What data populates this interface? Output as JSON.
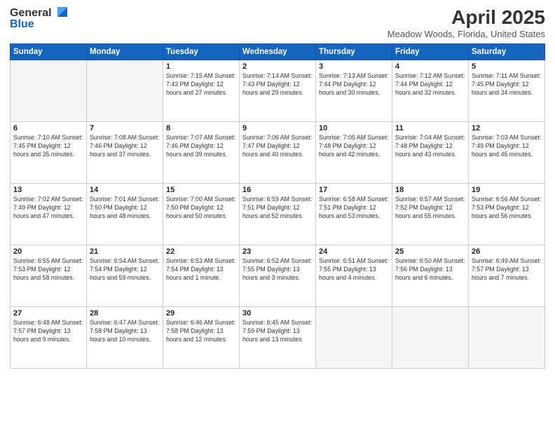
{
  "logo": {
    "general": "General",
    "blue": "Blue"
  },
  "title": "April 2025",
  "subtitle": "Meadow Woods, Florida, United States",
  "days_of_week": [
    "Sunday",
    "Monday",
    "Tuesday",
    "Wednesday",
    "Thursday",
    "Friday",
    "Saturday"
  ],
  "weeks": [
    [
      {
        "day": "",
        "info": ""
      },
      {
        "day": "",
        "info": ""
      },
      {
        "day": "1",
        "info": "Sunrise: 7:15 AM\nSunset: 7:43 PM\nDaylight: 12 hours and 27 minutes."
      },
      {
        "day": "2",
        "info": "Sunrise: 7:14 AM\nSunset: 7:43 PM\nDaylight: 12 hours and 29 minutes."
      },
      {
        "day": "3",
        "info": "Sunrise: 7:13 AM\nSunset: 7:44 PM\nDaylight: 12 hours and 30 minutes."
      },
      {
        "day": "4",
        "info": "Sunrise: 7:12 AM\nSunset: 7:44 PM\nDaylight: 12 hours and 32 minutes."
      },
      {
        "day": "5",
        "info": "Sunrise: 7:11 AM\nSunset: 7:45 PM\nDaylight: 12 hours and 34 minutes."
      }
    ],
    [
      {
        "day": "6",
        "info": "Sunrise: 7:10 AM\nSunset: 7:45 PM\nDaylight: 12 hours and 35 minutes."
      },
      {
        "day": "7",
        "info": "Sunrise: 7:08 AM\nSunset: 7:46 PM\nDaylight: 12 hours and 37 minutes."
      },
      {
        "day": "8",
        "info": "Sunrise: 7:07 AM\nSunset: 7:46 PM\nDaylight: 12 hours and 39 minutes."
      },
      {
        "day": "9",
        "info": "Sunrise: 7:06 AM\nSunset: 7:47 PM\nDaylight: 12 hours and 40 minutes."
      },
      {
        "day": "10",
        "info": "Sunrise: 7:05 AM\nSunset: 7:48 PM\nDaylight: 12 hours and 42 minutes."
      },
      {
        "day": "11",
        "info": "Sunrise: 7:04 AM\nSunset: 7:48 PM\nDaylight: 12 hours and 43 minutes."
      },
      {
        "day": "12",
        "info": "Sunrise: 7:03 AM\nSunset: 7:49 PM\nDaylight: 12 hours and 45 minutes."
      }
    ],
    [
      {
        "day": "13",
        "info": "Sunrise: 7:02 AM\nSunset: 7:49 PM\nDaylight: 12 hours and 47 minutes."
      },
      {
        "day": "14",
        "info": "Sunrise: 7:01 AM\nSunset: 7:50 PM\nDaylight: 12 hours and 48 minutes."
      },
      {
        "day": "15",
        "info": "Sunrise: 7:00 AM\nSunset: 7:50 PM\nDaylight: 12 hours and 50 minutes."
      },
      {
        "day": "16",
        "info": "Sunrise: 6:59 AM\nSunset: 7:51 PM\nDaylight: 12 hours and 52 minutes."
      },
      {
        "day": "17",
        "info": "Sunrise: 6:58 AM\nSunset: 7:51 PM\nDaylight: 12 hours and 53 minutes."
      },
      {
        "day": "18",
        "info": "Sunrise: 6:57 AM\nSunset: 7:52 PM\nDaylight: 12 hours and 55 minutes."
      },
      {
        "day": "19",
        "info": "Sunrise: 6:56 AM\nSunset: 7:53 PM\nDaylight: 12 hours and 56 minutes."
      }
    ],
    [
      {
        "day": "20",
        "info": "Sunrise: 6:55 AM\nSunset: 7:53 PM\nDaylight: 12 hours and 58 minutes."
      },
      {
        "day": "21",
        "info": "Sunrise: 6:54 AM\nSunset: 7:54 PM\nDaylight: 12 hours and 59 minutes."
      },
      {
        "day": "22",
        "info": "Sunrise: 6:53 AM\nSunset: 7:54 PM\nDaylight: 13 hours and 1 minute."
      },
      {
        "day": "23",
        "info": "Sunrise: 6:52 AM\nSunset: 7:55 PM\nDaylight: 13 hours and 3 minutes."
      },
      {
        "day": "24",
        "info": "Sunrise: 6:51 AM\nSunset: 7:55 PM\nDaylight: 13 hours and 4 minutes."
      },
      {
        "day": "25",
        "info": "Sunrise: 6:50 AM\nSunset: 7:56 PM\nDaylight: 13 hours and 6 minutes."
      },
      {
        "day": "26",
        "info": "Sunrise: 6:49 AM\nSunset: 7:57 PM\nDaylight: 13 hours and 7 minutes."
      }
    ],
    [
      {
        "day": "27",
        "info": "Sunrise: 6:48 AM\nSunset: 7:57 PM\nDaylight: 13 hours and 9 minutes."
      },
      {
        "day": "28",
        "info": "Sunrise: 6:47 AM\nSunset: 7:58 PM\nDaylight: 13 hours and 10 minutes."
      },
      {
        "day": "29",
        "info": "Sunrise: 6:46 AM\nSunset: 7:58 PM\nDaylight: 13 hours and 12 minutes."
      },
      {
        "day": "30",
        "info": "Sunrise: 6:45 AM\nSunset: 7:59 PM\nDaylight: 13 hours and 13 minutes."
      },
      {
        "day": "",
        "info": ""
      },
      {
        "day": "",
        "info": ""
      },
      {
        "day": "",
        "info": ""
      }
    ]
  ]
}
